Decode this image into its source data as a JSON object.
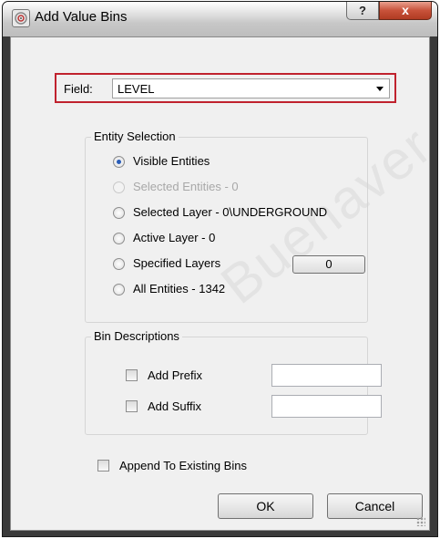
{
  "window": {
    "title": "Add Value Bins",
    "help_label": "?",
    "close_label": "x"
  },
  "field": {
    "label": "Field:",
    "value": "LEVEL"
  },
  "entity_selection": {
    "title": "Entity Selection",
    "options": [
      {
        "label": "Visible Entities",
        "checked": true,
        "enabled": true
      },
      {
        "label": "Selected Entities - 0",
        "checked": false,
        "enabled": false
      },
      {
        "label": "Selected Layer - 0\\UNDERGROUND",
        "checked": false,
        "enabled": true
      },
      {
        "label": "Active Layer - 0",
        "checked": false,
        "enabled": true
      },
      {
        "label": "Specified Layers",
        "checked": false,
        "enabled": true
      },
      {
        "label": "All Entities - 1342",
        "checked": false,
        "enabled": true
      }
    ],
    "specified_layers_button": "0"
  },
  "bin_descriptions": {
    "title": "Bin Descriptions",
    "add_prefix_label": "Add Prefix",
    "add_prefix_checked": false,
    "prefix_value": "",
    "add_suffix_label": "Add Suffix",
    "add_suffix_checked": false,
    "suffix_value": ""
  },
  "append": {
    "label": "Append To Existing Bins",
    "checked": false
  },
  "buttons": {
    "ok": "OK",
    "cancel": "Cancel"
  },
  "watermark": "Buenaver"
}
